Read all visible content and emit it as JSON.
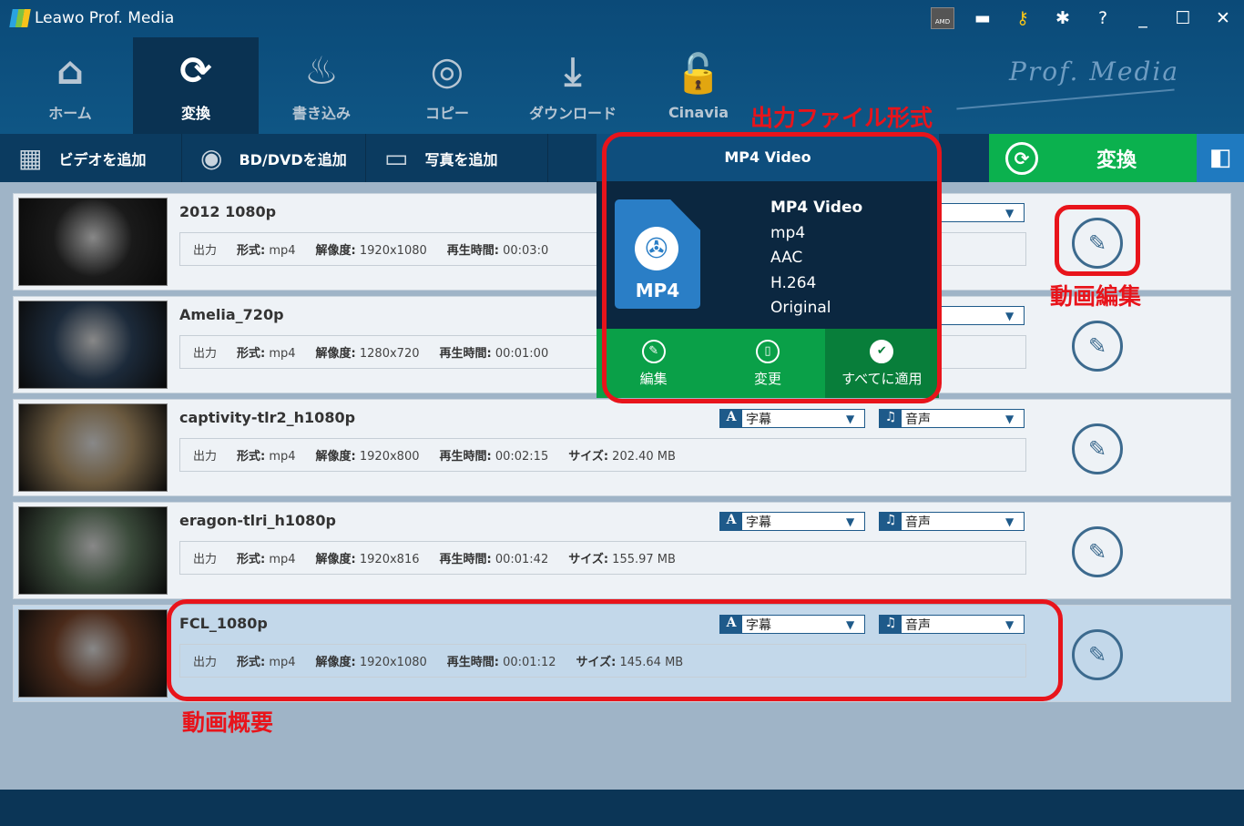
{
  "app": {
    "title": "Leawo Prof. Media",
    "brand": "Prof. Media"
  },
  "window_icons": [
    "amd-badge",
    "feedback-icon",
    "key-icon",
    "gear-icon",
    "help-icon",
    "minimize-icon",
    "maximize-icon",
    "close-icon"
  ],
  "nav": [
    {
      "label": "ホーム",
      "icon": "home-icon"
    },
    {
      "label": "変換",
      "icon": "convert-icon",
      "active": true
    },
    {
      "label": "書き込み",
      "icon": "burn-icon"
    },
    {
      "label": "コピー",
      "icon": "copy-icon"
    },
    {
      "label": "ダウンロード",
      "icon": "download-icon"
    },
    {
      "label": "Cinavia",
      "icon": "cinavia-icon"
    }
  ],
  "toolbar": {
    "add_video": "ビデオを追加",
    "add_bd": "BD/DVDを追加",
    "add_photo": "写真を追加",
    "convert": "変換"
  },
  "annotations": {
    "format": "出力ファイル形式",
    "edit": "動画編集",
    "summary": "動画概要"
  },
  "popup": {
    "title": "MP4 Video",
    "file_label": "MP4",
    "specs": [
      "MP4 Video",
      "mp4",
      "AAC",
      "H.264",
      "Original"
    ],
    "actions": [
      "編集",
      "変更",
      "すべてに適用"
    ]
  },
  "labels": {
    "output": "出力",
    "format": "形式:",
    "resolution": "解像度:",
    "duration": "再生時間:",
    "size": "サイズ:",
    "subtitle": "字幕",
    "audio": "音声",
    "subtitle_badge": "A",
    "audio_badge": "♫"
  },
  "rows": [
    {
      "name": "2012 1080p",
      "format": "mp4",
      "resolution": "1920x1080",
      "duration": "00:03:0",
      "size": null,
      "thumb": "#1a1a1a"
    },
    {
      "name": "Amelia_720p",
      "format": "mp4",
      "resolution": "1280x720",
      "duration": "00:01:00",
      "size": null,
      "thumb": "#1c2a3a"
    },
    {
      "name": "captivity-tlr2_h1080p",
      "format": "mp4",
      "resolution": "1920x800",
      "duration": "00:02:15",
      "size": "202.40 MB",
      "thumb": "#6b5a40"
    },
    {
      "name": "eragon-tlri_h1080p",
      "format": "mp4",
      "resolution": "1920x816",
      "duration": "00:01:42",
      "size": "155.97 MB",
      "thumb": "#3a4a3a"
    },
    {
      "name": "FCL_1080p",
      "format": "mp4",
      "resolution": "1920x1080",
      "duration": "00:01:12",
      "size": "145.64 MB",
      "thumb": "#4a2a1a",
      "selected": true
    }
  ]
}
